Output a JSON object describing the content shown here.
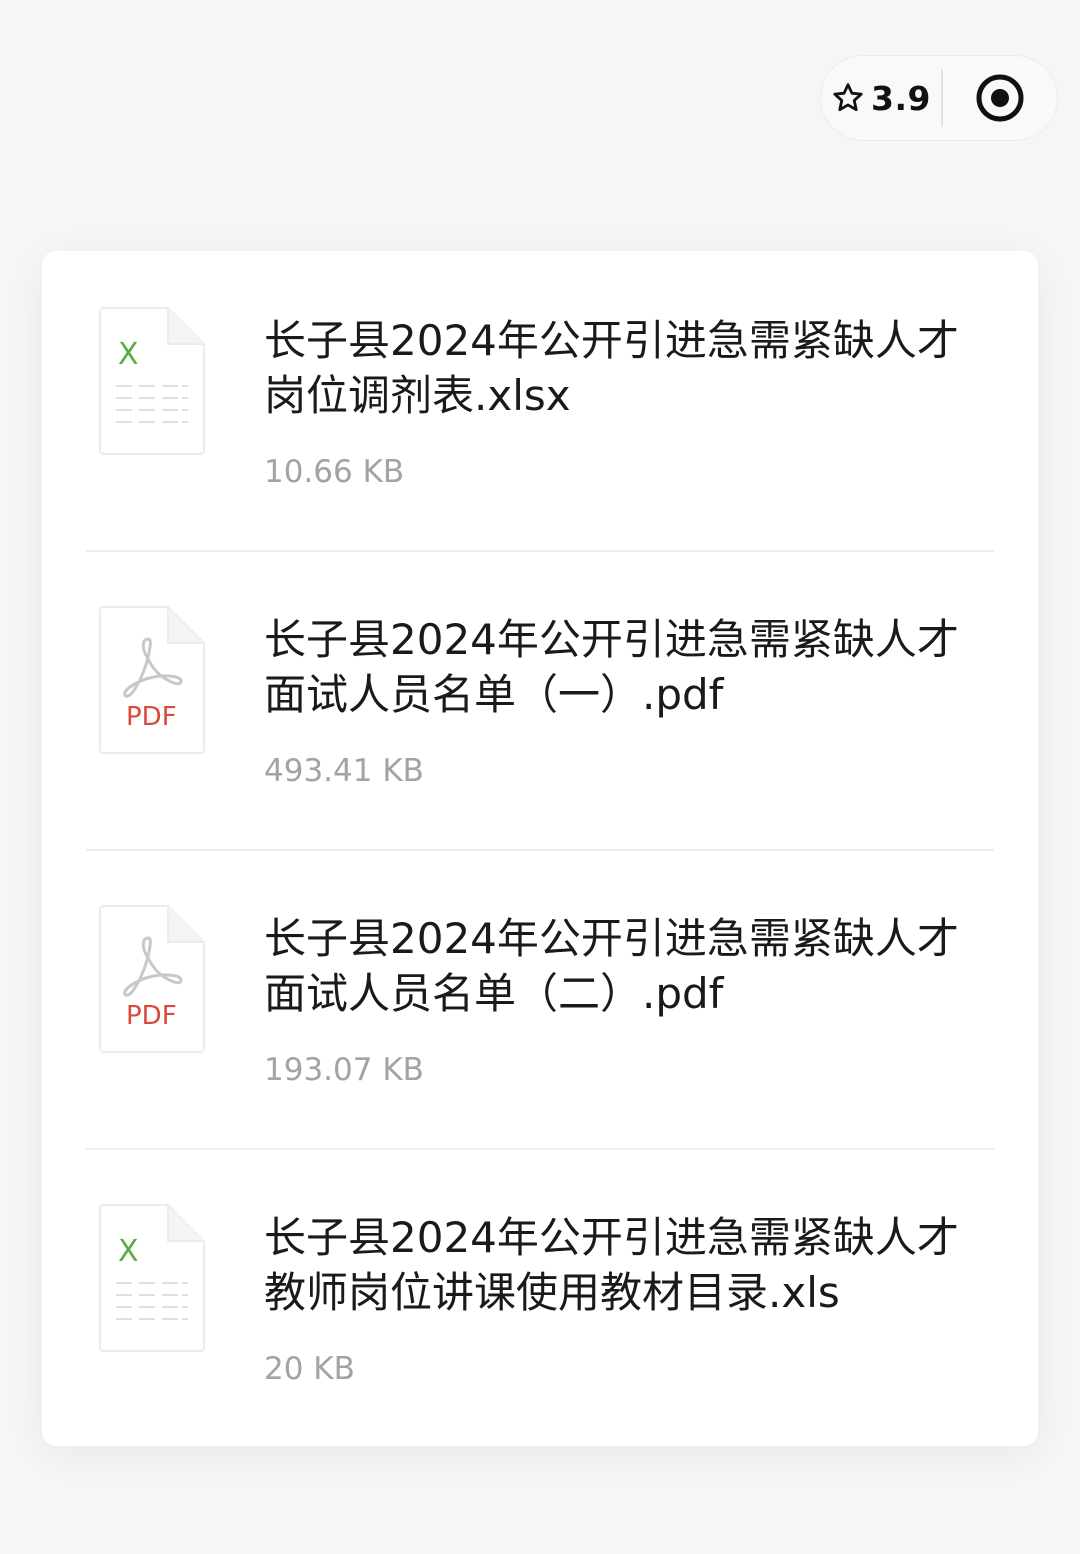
{
  "capsule": {
    "rating": "3.9",
    "rating_icon": "star-outline-icon",
    "target_icon": "record-target-icon"
  },
  "files": [
    {
      "name": "长子县2024年公开引进急需紧缺人才岗位调剂表.xlsx",
      "size": "10.66 KB",
      "icon": "excel-file-icon",
      "badge": "X"
    },
    {
      "name": "长子县2024年公开引进急需紧缺人才面试人员名单（一）.pdf",
      "size": "493.41 KB",
      "icon": "pdf-file-icon",
      "badge": "PDF"
    },
    {
      "name": "长子县2024年公开引进急需紧缺人才面试人员名单（二）.pdf",
      "size": "193.07 KB",
      "icon": "pdf-file-icon",
      "badge": "PDF"
    },
    {
      "name": "长子县2024年公开引进急需紧缺人才教师岗位讲课使用教材目录.xls",
      "size": "20 KB",
      "icon": "excel-file-icon",
      "badge": "X"
    }
  ],
  "colors": {
    "excel": "#5aad3f",
    "pdf": "#d94a3c",
    "lines": "#e0e0e2"
  }
}
